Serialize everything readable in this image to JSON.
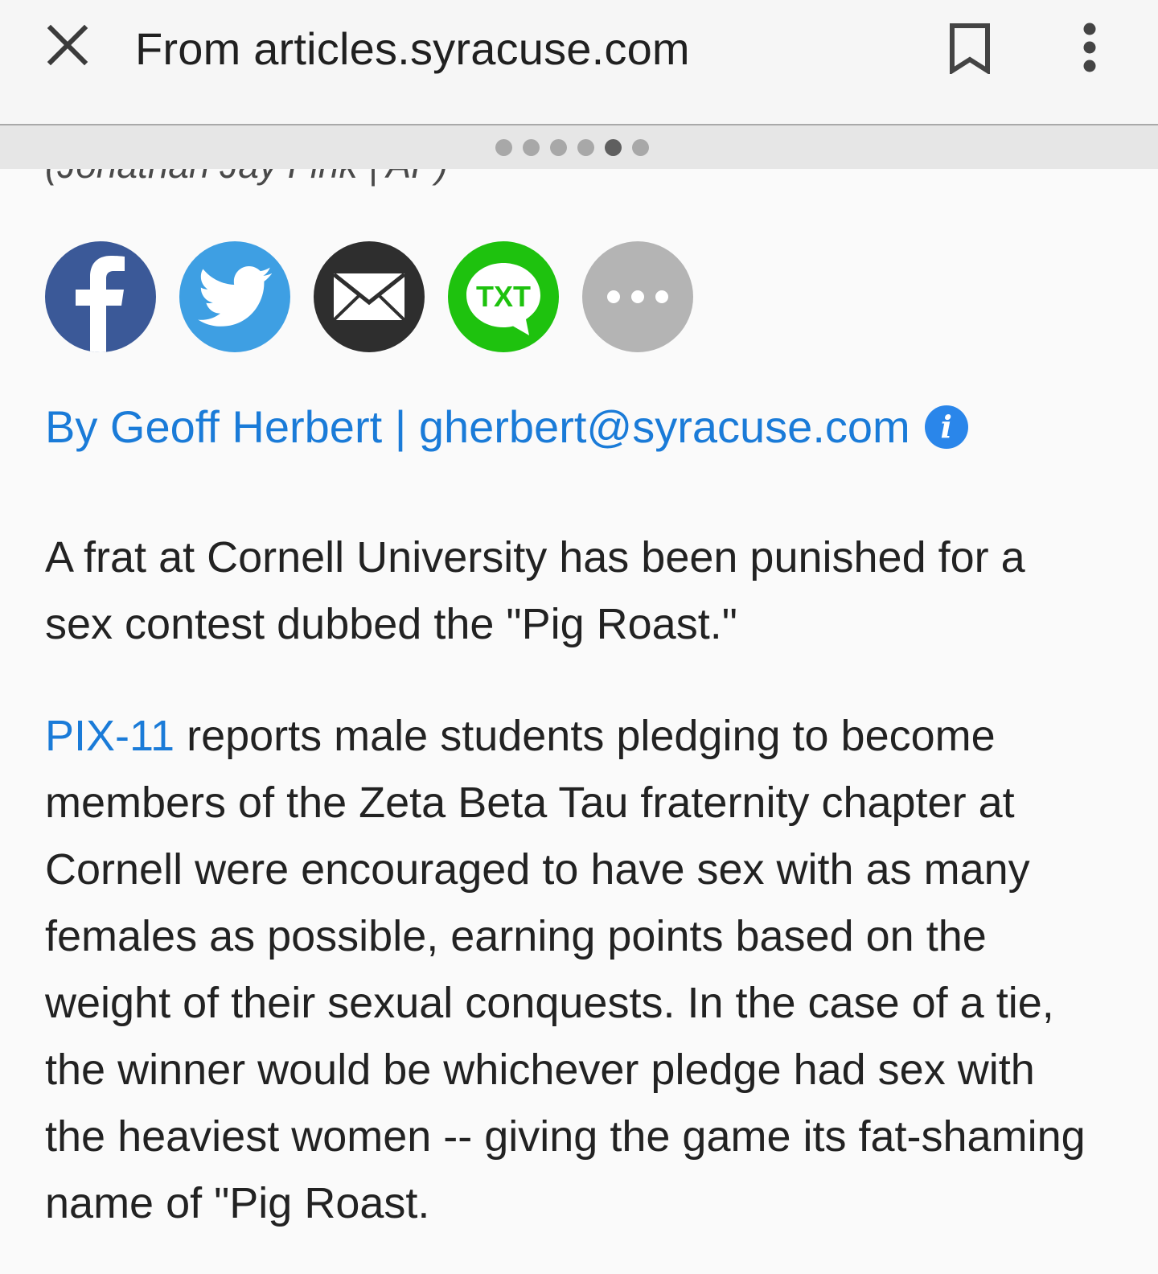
{
  "header": {
    "title": "From articles.syracuse.com",
    "close_icon": "close-icon",
    "bookmark_icon": "bookmark-icon",
    "menu_icon": "more-vert-icon"
  },
  "pager": {
    "total": 6,
    "active_index": 4
  },
  "article": {
    "photo_caption": "(Jonathan Jay Fink | AP)",
    "share_buttons": [
      {
        "name": "facebook",
        "icon": "facebook-icon",
        "color": "#3b5998"
      },
      {
        "name": "twitter",
        "icon": "twitter-icon",
        "color": "#3e9fe3"
      },
      {
        "name": "email",
        "icon": "email-icon",
        "color": "#2e2e2e"
      },
      {
        "name": "sms",
        "icon": "txt-icon",
        "color": "#1ec20e",
        "label": "TXT"
      },
      {
        "name": "more",
        "icon": "more-horiz-icon",
        "color": "#b4b4b4"
      }
    ],
    "byline": "By Geoff Herbert | gherbert@syracuse.com",
    "paragraph1": "A frat at Cornell University has been punished for a sex contest dubbed the \"Pig Roast.\"",
    "paragraph2_link": "PIX-11",
    "paragraph2_text": " reports male students pledging to become members of the Zeta Beta Tau fraternity chapter at Cornell were encouraged to have sex with as many females as possible, earning points based on the weight of their sexual conquests. In the case of a tie, the winner would be whichever pledge had sex with the heaviest women -- giving the game its fat-shaming name of \"Pig Roast."
  },
  "colors": {
    "link": "#1a7bd8",
    "info_badge": "#2a86ea"
  }
}
